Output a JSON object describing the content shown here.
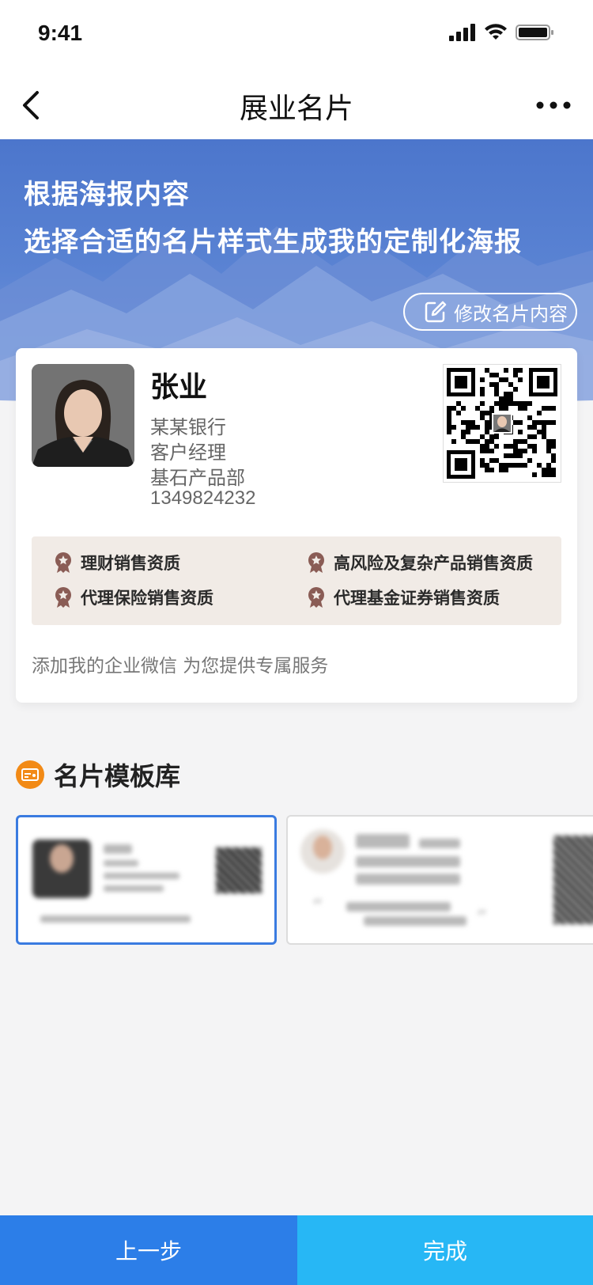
{
  "status_bar": {
    "time": "9:41"
  },
  "nav": {
    "title": "展业名片"
  },
  "hero": {
    "line1": "根据海报内容",
    "line2": "选择合适的名片样式生成我的定制化海报",
    "edit_label": "修改名片内容"
  },
  "card": {
    "name": "张业",
    "bank": "某某银行",
    "role": "客户经理",
    "department": "基石产品部",
    "phone": "1349824232",
    "qualifications": [
      "理财销售资质",
      "高风险及复杂产品销售资质",
      "代理保险销售资质",
      "代理基金证券销售资质"
    ],
    "footer": "添加我的企业微信 为您提供专属服务"
  },
  "template_library": {
    "title": "名片模板库"
  },
  "buttons": {
    "prev": "上一步",
    "done": "完成"
  },
  "colors": {
    "primary": "#2c7ee8",
    "secondary": "#27b7f5",
    "accent": "#f28a16",
    "qual_bg": "#f1ebe6"
  }
}
